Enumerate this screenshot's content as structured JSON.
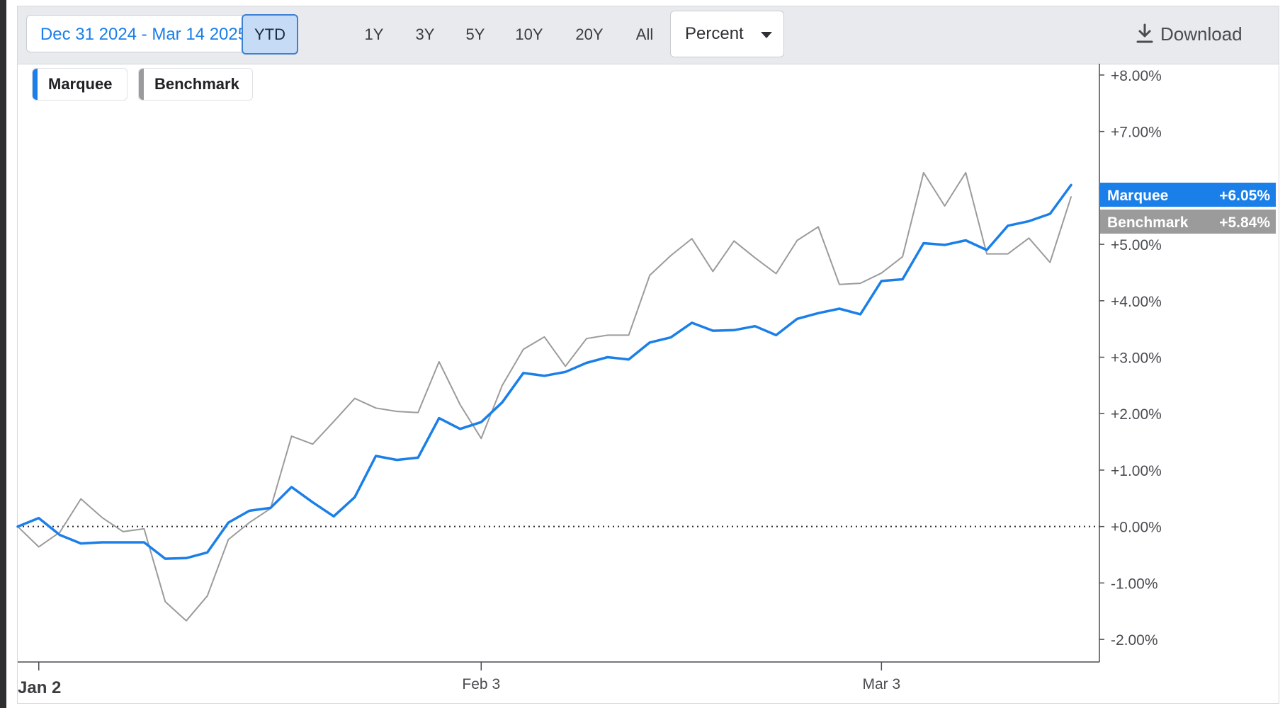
{
  "toolbar": {
    "date_range": "Dec 31 2024 - Mar 14 2025",
    "ranges": [
      {
        "label": "YTD",
        "active": true
      },
      {
        "label": "1Y",
        "active": false
      },
      {
        "label": "3Y",
        "active": false
      },
      {
        "label": "5Y",
        "active": false
      },
      {
        "label": "10Y",
        "active": false
      },
      {
        "label": "20Y",
        "active": false
      },
      {
        "label": "All",
        "active": false
      }
    ],
    "unit_select": {
      "selected": "Percent",
      "icon": "caret-down-icon"
    },
    "download": {
      "label": "Download",
      "icon": "download-icon"
    }
  },
  "legend": [
    {
      "name": "Marquee",
      "color": "#1a7fe8"
    },
    {
      "name": "Benchmark",
      "color": "#9b9b9b"
    }
  ],
  "chart_data": {
    "type": "line",
    "x_ticks": [
      "Jan 2",
      "Feb 3",
      "Mar 3"
    ],
    "x_tick_index": [
      1,
      22,
      41
    ],
    "y_ticks": [
      "-2.00%",
      "-1.00%",
      "+0.00%",
      "+1.00%",
      "+2.00%",
      "+3.00%",
      "+4.00%",
      "+5.00%",
      "+6.00%",
      "+7.00%",
      "+8.00%"
    ],
    "ylim": [
      -2.4,
      8.2
    ],
    "y_unit": "%",
    "baseline": 0,
    "grid": false,
    "legend_position": "top-left",
    "series": [
      {
        "name": "Marquee",
        "color": "#1a7fe8",
        "last_label": "+6.05%",
        "values": [
          0,
          0.15,
          -0.15,
          -0.3,
          -0.28,
          -0.28,
          -0.28,
          -0.57,
          -0.56,
          -0.46,
          0.07,
          0.28,
          0.33,
          0.7,
          0.43,
          0.18,
          0.52,
          1.25,
          1.18,
          1.22,
          1.92,
          1.73,
          1.85,
          2.2,
          2.72,
          2.67,
          2.74,
          2.9,
          3.0,
          2.96,
          3.26,
          3.35,
          3.61,
          3.47,
          3.48,
          3.55,
          3.39,
          3.68,
          3.78,
          3.86,
          3.76,
          4.35,
          4.38,
          5.02,
          4.99,
          5.07,
          4.9,
          5.33,
          5.41,
          5.54,
          6.05
        ]
      },
      {
        "name": "Benchmark",
        "color": "#9b9b9b",
        "last_label": "+5.84%",
        "values": [
          0,
          -0.36,
          -0.1,
          0.49,
          0.16,
          -0.09,
          -0.04,
          -1.33,
          -1.67,
          -1.23,
          -0.23,
          0.07,
          0.32,
          1.6,
          1.46,
          1.86,
          2.27,
          2.1,
          2.04,
          2.02,
          2.92,
          2.16,
          1.56,
          2.5,
          3.14,
          3.36,
          2.84,
          3.33,
          3.39,
          3.39,
          4.45,
          4.8,
          5.1,
          4.52,
          5.06,
          4.76,
          4.48,
          5.07,
          5.31,
          4.29,
          4.31,
          4.49,
          4.78,
          6.27,
          5.68,
          6.27,
          4.83,
          4.83,
          5.11,
          4.68,
          5.84
        ]
      }
    ]
  }
}
